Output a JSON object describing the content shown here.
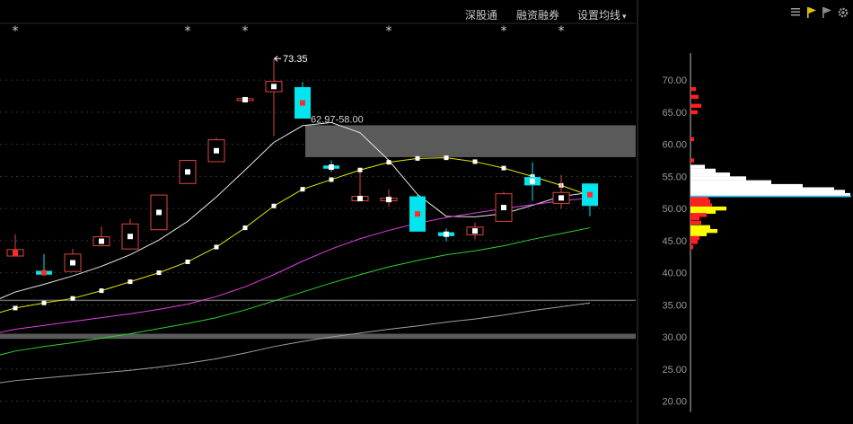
{
  "toolbar": {
    "items": [
      "深股通",
      "融资融券",
      "设置均线"
    ],
    "dropdown_caret": "▾",
    "right_icons": [
      "bars-icon",
      "flag-yellow-icon",
      "flag-gray-icon",
      "gear-icon"
    ]
  },
  "colors": {
    "background": "#000000",
    "up_candle": "#e0463c",
    "down_candle": "#00e5ee",
    "ma_white": "#e8e8e8",
    "ma_yellow": "#e6e600",
    "ma_magenta": "#e040e0",
    "ma_green": "#30d030",
    "ma_long": "#a0a0a0",
    "band_gray": "#5a5a5a",
    "chip_red": "#ff2020",
    "chip_white": "#ffffff",
    "chip_yellow": "#ffff00",
    "chip_cyan_line": "#29c8ff"
  },
  "chart_data": {
    "type": "candlestick",
    "y_axis_labels": [
      "70.00",
      "65.00",
      "60.00",
      "55.00",
      "50.00",
      "45.00",
      "40.00",
      "35.00",
      "30.00",
      "25.00",
      "20.00"
    ],
    "y_ticks": [
      70,
      65,
      60,
      55,
      50,
      45,
      40,
      35,
      30,
      25,
      20
    ],
    "ylim": [
      17.7,
      75.2
    ],
    "candles": [
      {
        "o": 42.6,
        "h": 46.0,
        "l": 42.6,
        "c": 43.6,
        "dot": "red"
      },
      {
        "o": 40.3,
        "h": 42.9,
        "l": 39.7,
        "c": 39.7,
        "dot": "red"
      },
      {
        "o": 40.2,
        "h": 43.7,
        "l": 40.2,
        "c": 42.9,
        "dot": "white"
      },
      {
        "o": 44.2,
        "h": 47.2,
        "l": 44.2,
        "c": 45.6,
        "dot": "white"
      },
      {
        "o": 43.7,
        "h": 48.4,
        "l": 43.7,
        "c": 47.6,
        "dot": "white"
      },
      {
        "o": 46.7,
        "h": 52.1,
        "l": 46.7,
        "c": 52.1,
        "dot": "white"
      },
      {
        "o": 53.9,
        "h": 57.5,
        "l": 53.9,
        "c": 57.5,
        "dot": "white"
      },
      {
        "o": 57.3,
        "h": 61.0,
        "l": 57.3,
        "c": 60.7,
        "dot": "white"
      },
      {
        "o": 66.8,
        "h": 67.2,
        "l": 66.8,
        "c": 67.1,
        "dot": "white"
      },
      {
        "o": 68.2,
        "h": 73.35,
        "l": 61.3,
        "c": 69.8,
        "dot": "white"
      },
      {
        "o": 68.9,
        "h": 69.7,
        "l": 64.0,
        "c": 64.0,
        "dot": "red"
      },
      {
        "o": 56.7,
        "h": 57.5,
        "l": 55.7,
        "c": 56.2,
        "dot": "white"
      },
      {
        "o": 51.2,
        "h": 55.7,
        "l": 51.2,
        "c": 51.9,
        "dot": "white"
      },
      {
        "o": 51.2,
        "h": 53.0,
        "l": 50.3,
        "c": 51.6,
        "dot": "white"
      },
      {
        "o": 51.9,
        "h": 52.2,
        "l": 46.4,
        "c": 46.4,
        "dot": "red"
      },
      {
        "o": 46.3,
        "h": 46.9,
        "l": 44.9,
        "c": 45.7,
        "dot": "white"
      },
      {
        "o": 45.9,
        "h": 47.8,
        "l": 45.2,
        "c": 47.1,
        "dot": "white"
      },
      {
        "o": 48.0,
        "h": 52.6,
        "l": 48.0,
        "c": 52.3,
        "dot": "white"
      },
      {
        "o": 54.9,
        "h": 57.2,
        "l": 51.2,
        "c": 53.6,
        "dot": "white"
      },
      {
        "o": 50.8,
        "h": 55.2,
        "l": 50.0,
        "c": 52.5,
        "dot": "white"
      },
      {
        "o": 53.9,
        "h": 53.9,
        "l": 48.8,
        "c": 50.4,
        "dot": "red"
      }
    ],
    "markers": [
      "*",
      "",
      "",
      "",
      "",
      "",
      "*",
      "",
      "*",
      "",
      "",
      "",
      "",
      "*",
      "",
      "",
      "",
      "*",
      "",
      "*"
    ],
    "moving_averages": [
      {
        "name": "",
        "values": [
          37.0,
          38.2,
          39.5,
          41.0,
          42.8,
          45.1,
          48.0,
          51.8,
          56.0,
          60.3,
          62.9,
          63.4,
          61.8,
          57.5,
          52.2,
          48.8,
          48.7,
          49.2,
          50.5,
          51.9,
          52.5
        ]
      },
      {
        "name": "",
        "values": [
          34.5,
          35.3,
          36.0,
          37.2,
          38.6,
          40.0,
          41.7,
          44.0,
          47.0,
          50.4,
          53.0,
          54.5,
          56.0,
          57.2,
          57.8,
          57.9,
          57.3,
          56.3,
          55.0,
          53.6,
          52.0
        ]
      },
      {
        "name": "",
        "values": [
          31.2,
          31.8,
          32.4,
          33.0,
          33.6,
          34.3,
          35.1,
          36.3,
          37.8,
          39.7,
          41.8,
          43.7,
          45.3,
          46.6,
          47.7,
          48.6,
          49.3,
          50.0,
          50.6,
          51.2,
          51.6
        ]
      },
      {
        "name": "",
        "values": [
          27.8,
          28.5,
          29.1,
          29.8,
          30.5,
          31.3,
          32.1,
          33.0,
          34.2,
          35.6,
          37.0,
          38.4,
          39.7,
          40.9,
          41.9,
          42.8,
          43.4,
          44.2,
          45.2,
          46.1,
          47.0
        ]
      },
      {
        "name": "",
        "values": [
          23.2,
          23.6,
          24.0,
          24.4,
          24.8,
          25.3,
          25.9,
          26.6,
          27.5,
          28.5,
          29.3,
          30.0,
          30.6,
          31.2,
          31.7,
          32.3,
          32.8,
          33.4,
          34.1,
          34.7,
          35.3
        ]
      }
    ],
    "annotations": {
      "high_label": "73.35",
      "range_label": "62.97-58.00"
    },
    "range_band": {
      "top": 62.97,
      "bottom": 58.0
    },
    "lower_band": {
      "top": 30.5,
      "bottom": 29.7
    },
    "hline_price": 35.7,
    "chip_distribution": {
      "rows": [
        {
          "p": 68.6,
          "w": 6,
          "c": "red"
        },
        {
          "p": 67.4,
          "w": 9,
          "c": "red"
        },
        {
          "p": 66.0,
          "w": 12,
          "c": "red"
        },
        {
          "p": 65.0,
          "w": 8,
          "c": "red"
        },
        {
          "p": 60.8,
          "w": 4,
          "c": "red"
        },
        {
          "p": 57.5,
          "w": 4,
          "c": "red"
        },
        {
          "p": 56.5,
          "w": 16,
          "c": "white"
        },
        {
          "p": 55.9,
          "w": 28,
          "c": "white"
        },
        {
          "p": 55.3,
          "w": 44,
          "c": "white"
        },
        {
          "p": 54.7,
          "w": 62,
          "c": "white"
        },
        {
          "p": 54.1,
          "w": 90,
          "c": "white"
        },
        {
          "p": 53.5,
          "w": 125,
          "c": "white"
        },
        {
          "p": 53.0,
          "w": 160,
          "c": "white"
        },
        {
          "p": 52.6,
          "w": 172,
          "c": "white"
        },
        {
          "p": 52.1,
          "w": 178,
          "c": "white"
        },
        {
          "p": 51.6,
          "w": 20,
          "c": "red"
        },
        {
          "p": 51.1,
          "w": 22,
          "c": "red"
        },
        {
          "p": 50.5,
          "w": 24,
          "c": "red"
        },
        {
          "p": 50.0,
          "w": 40,
          "c": "yellow"
        },
        {
          "p": 49.5,
          "w": 28,
          "c": "yellow"
        },
        {
          "p": 49.0,
          "w": 18,
          "c": "red"
        },
        {
          "p": 48.5,
          "w": 10,
          "c": "red"
        },
        {
          "p": 47.8,
          "w": 12,
          "c": "red"
        },
        {
          "p": 47.1,
          "w": 22,
          "c": "yellow"
        },
        {
          "p": 46.5,
          "w": 30,
          "c": "yellow"
        },
        {
          "p": 46.0,
          "w": 18,
          "c": "yellow"
        },
        {
          "p": 45.4,
          "w": 10,
          "c": "red"
        },
        {
          "p": 44.8,
          "w": 8,
          "c": "red"
        },
        {
          "p": 44.0,
          "w": 3,
          "c": "red"
        }
      ],
      "peak_price": 51.9
    }
  }
}
